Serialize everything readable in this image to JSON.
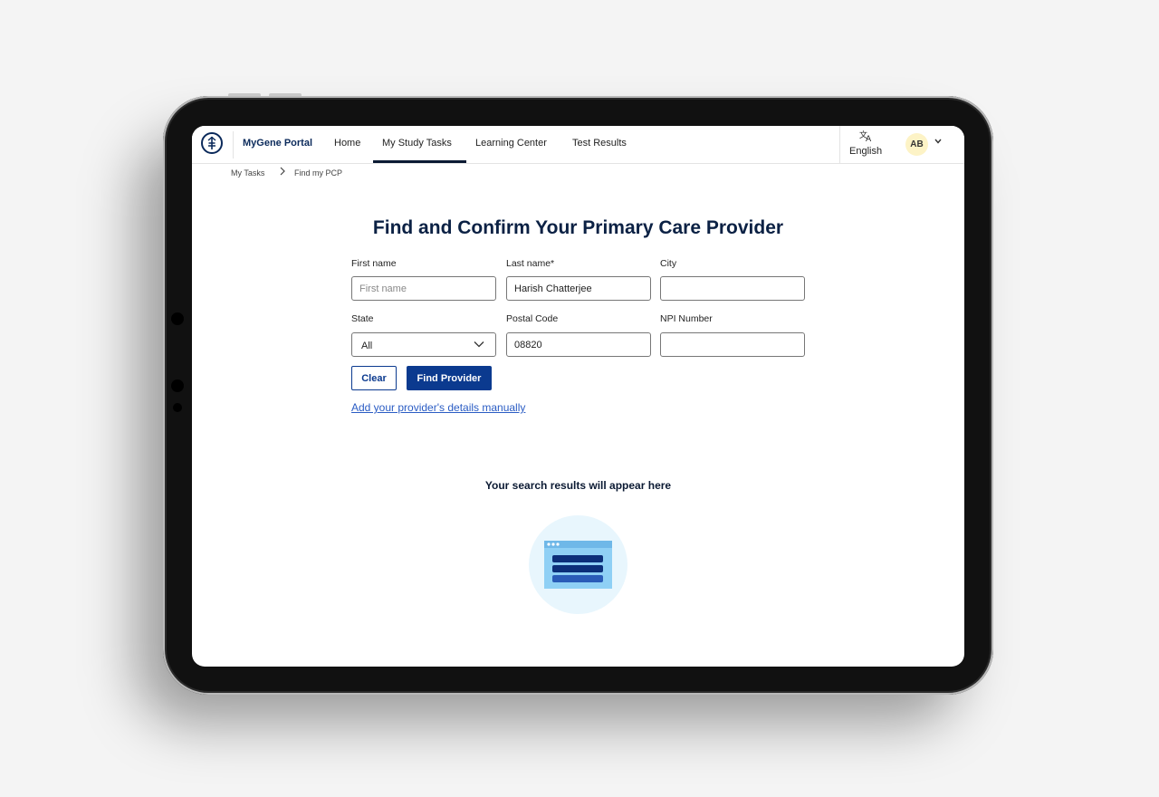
{
  "nav": {
    "brand": "MyGene Portal",
    "items": [
      "Home",
      "My Study Tasks",
      "Learning Center",
      "Test Results"
    ],
    "active_index": 1,
    "language_icon": "translate-icon",
    "language_label": "English",
    "avatar_initials": "AB"
  },
  "breadcrumb": [
    "My Tasks",
    "Find my PCP"
  ],
  "form": {
    "title": "Find and Confirm Your Primary Care Provider",
    "first_name": {
      "label": "First name",
      "placeholder": "First name",
      "value": ""
    },
    "last_name": {
      "label": "Last name*",
      "value": "Harish Chatterjee"
    },
    "city": {
      "label": "City",
      "value": ""
    },
    "state": {
      "label": "State",
      "value": "All"
    },
    "postal_code": {
      "label": "Postal Code",
      "value": "08820"
    },
    "npi_number": {
      "label": "NPI Number",
      "value": ""
    },
    "clear_label": "Clear",
    "find_label": "Find Provider",
    "manual_link": "Add your provider's details manually"
  },
  "results": {
    "empty_text": "Your search results will appear here"
  },
  "colors": {
    "primary": "#0b3a8f",
    "heading": "#0b2144",
    "link": "#2a5cc4",
    "avatar_bg": "#fdf3c6"
  }
}
